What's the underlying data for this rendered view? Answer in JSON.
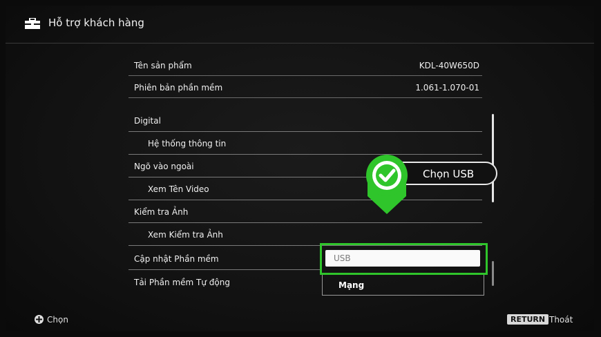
{
  "header": {
    "title": "Hỗ trợ khách hàng",
    "icon": "toolbox-icon"
  },
  "info": [
    {
      "label": "Tên sản phẩm",
      "value": "KDL-40W650D"
    },
    {
      "label": "Phiên bản phần mềm",
      "value": "1.061-1.070-01"
    }
  ],
  "menu": [
    {
      "label": "Digital"
    },
    {
      "label": "Hệ thống thông tin"
    },
    {
      "label": "Ngõ vào ngoài"
    },
    {
      "label": "Xem Tên Video"
    },
    {
      "label": "Kiểm tra Ảnh"
    },
    {
      "label": "Xem Kiểm tra Ảnh"
    },
    {
      "label": "Cập nhật Phần mềm"
    },
    {
      "label": "Tải Phần mềm Tự động"
    }
  ],
  "dropdown": {
    "selected": "USB",
    "option2": "Mạng"
  },
  "callout": {
    "text": "Chọn USB"
  },
  "footer": {
    "select_label": "Chọn",
    "return_key": "RETURN",
    "exit_label": "Thoát"
  },
  "colors": {
    "accent_green": "#2fc52b",
    "background": "#121212"
  }
}
